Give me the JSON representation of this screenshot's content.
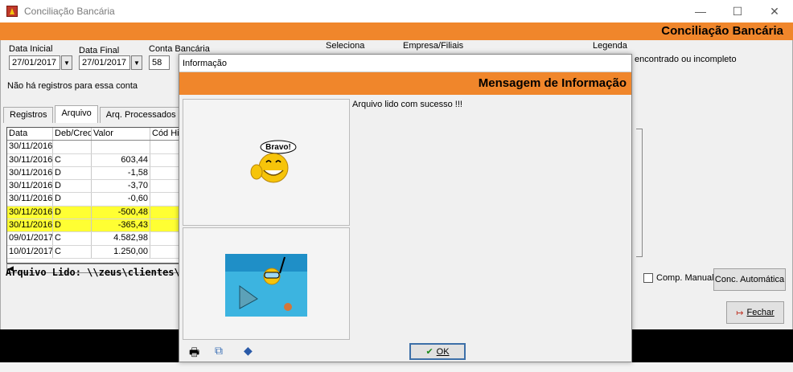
{
  "window": {
    "title": "Conciliação Bancária",
    "minimize": "—",
    "maximize": "☐",
    "close": "✕"
  },
  "header": {
    "title": "Conciliação Bancária"
  },
  "filters": {
    "data_inicial_label": "Data Inicial",
    "data_inicial_value": "27/01/2017",
    "data_final_label": "Data Final",
    "data_final_value": "27/01/2017",
    "conta_label": "Conta Bancária",
    "conta_value": "58",
    "seleciona_label": "Seleciona",
    "empresa_label": "Empresa/Filiais",
    "legenda_label": "Legenda",
    "legenda_text": "encontrado ou incompleto",
    "status_text": "Não há registros para essa conta"
  },
  "tabs": [
    {
      "label": "Registros"
    },
    {
      "label": "Arquivo"
    },
    {
      "label": "Arq. Processados"
    }
  ],
  "grid": {
    "columns": [
      "Data",
      "Deb/Cred",
      "Valor",
      "Cód Hist"
    ],
    "rows": [
      {
        "date": "30/11/2016",
        "dc": "",
        "value": "",
        "hl": false
      },
      {
        "date": "30/11/2016",
        "dc": "C",
        "value": "603,44",
        "hl": false
      },
      {
        "date": "30/11/2016",
        "dc": "D",
        "value": "-1,58",
        "hl": false
      },
      {
        "date": "30/11/2016",
        "dc": "D",
        "value": "-3,70",
        "hl": false
      },
      {
        "date": "30/11/2016",
        "dc": "D",
        "value": "-0,60",
        "hl": false
      },
      {
        "date": "30/11/2016",
        "dc": "D",
        "value": "-500,48",
        "hl": true
      },
      {
        "date": "30/11/2016",
        "dc": "D",
        "value": "-365,43",
        "hl": true
      },
      {
        "date": "09/01/2017",
        "dc": "C",
        "value": "4.582,98",
        "hl": false
      },
      {
        "date": "10/01/2017",
        "dc": "C",
        "value": "1.250,00",
        "hl": false
      }
    ]
  },
  "arquivo_lido": "Arquivo Lido: \\\\zeus\\clientes\\E",
  "buttons": {
    "comp_manual": "Comp. Manual",
    "conc_automatica": "Conc. Automática",
    "fechar": "Fechar"
  },
  "modal": {
    "title": "Informação",
    "header": "Mensagem de Informação",
    "message": "Arquivo lido com sucesso !!!",
    "bravo": "Bravo!",
    "ok": "OK"
  },
  "colors": {
    "accent": "#f0862b",
    "highlight": "#ffff33"
  }
}
